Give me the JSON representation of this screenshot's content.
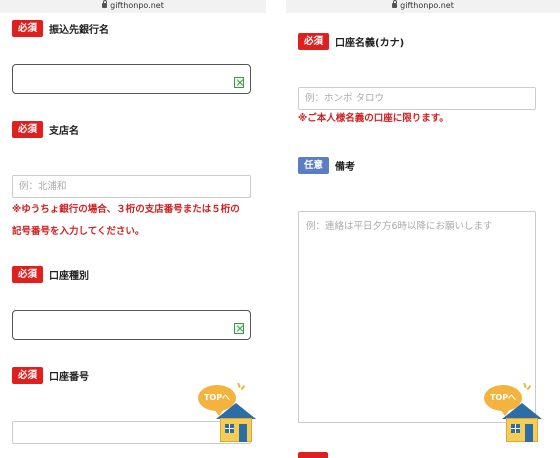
{
  "left": {
    "url": "gifthonpo.net",
    "bank_name": {
      "badge": "必須",
      "label": "振込先銀行名"
    },
    "branch_name": {
      "badge": "必須",
      "label": "支店名",
      "placeholder": "例：北浦和"
    },
    "branch_note_line1": "※ゆうちょ銀行の場合、３桁の支店番号または５桁の",
    "branch_note_line2": "記号番号を入力してください。",
    "account_type": {
      "badge": "必須",
      "label": "口座種別"
    },
    "account_number": {
      "badge": "必須",
      "label": "口座番号"
    },
    "top_button": "TOPへ"
  },
  "right": {
    "url": "gifthonpo.net",
    "account_holder": {
      "badge": "必須",
      "label": "口座名義(カナ)",
      "placeholder": "例：ホンポ タロウ"
    },
    "holder_note": "※ご本人様名義の口座に限ります。",
    "remarks": {
      "badge": "任意",
      "label": "備考",
      "placeholder": "例：連絡は平日夕方6時以降にお願いします"
    },
    "top_button": "TOPへ"
  },
  "colors": {
    "required_badge": "#e0201f",
    "optional_badge": "#5b7dc6",
    "note_text": "#d0201f",
    "top_bubble": "#f3b33c"
  },
  "icons": {
    "lock": "lock-icon",
    "broken_image": "broken-image-icon",
    "top": "house-icon"
  }
}
